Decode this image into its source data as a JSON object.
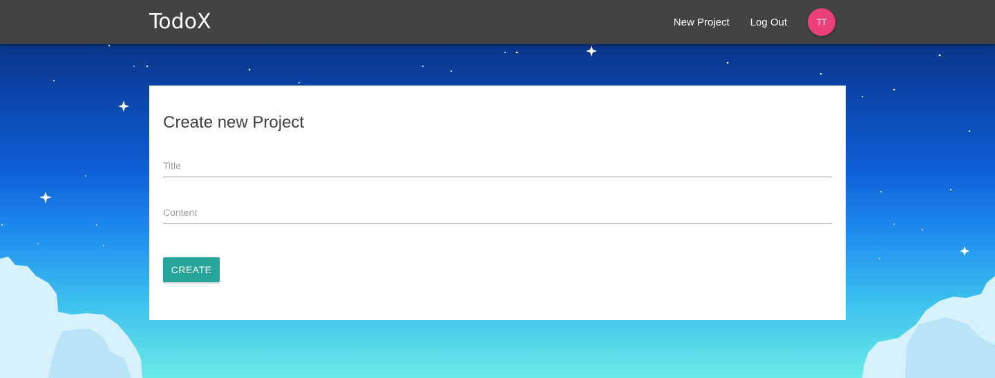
{
  "navbar": {
    "brand": "TodoX",
    "links": [
      "New Project",
      "Log Out"
    ],
    "avatar_initials": "TT"
  },
  "form": {
    "heading": "Create new Project",
    "title_placeholder": "Title",
    "title_value": "",
    "content_placeholder": "Content",
    "content_value": "",
    "submit_label": "CREATE"
  },
  "colors": {
    "navbar": "#434343",
    "avatar": "#ec407a",
    "button": "#26a69a",
    "card": "#ffffff"
  }
}
